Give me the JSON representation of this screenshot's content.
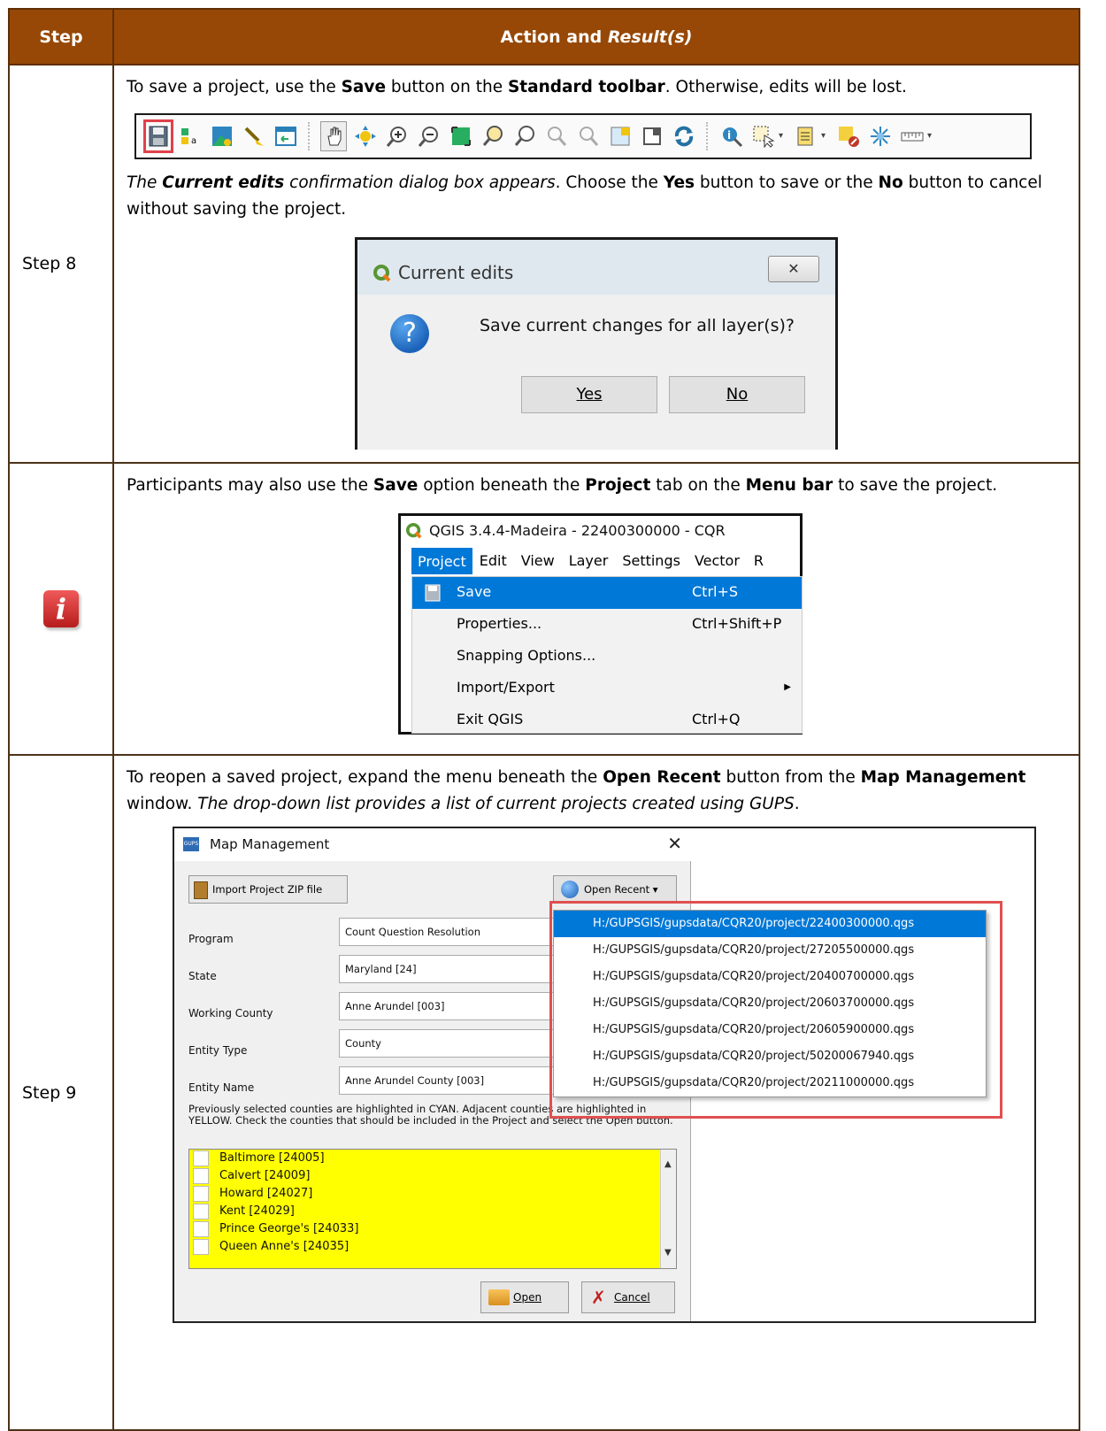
{
  "header": {
    "step": "Step",
    "action": "Action and ",
    "result": "Result(s)"
  },
  "row8": {
    "step": "Step 8",
    "p1": {
      "a": "To save a project, use the ",
      "b1": "Save",
      "c": " button on the ",
      "b2": "Standard toolbar",
      "d": ". Otherwise, edits will be lost."
    },
    "p2": {
      "i1": "The ",
      "bi": "Current edits",
      "i2": " confirmation dialog box appears",
      "a": ". Choose the ",
      "b1": "Yes",
      "c": " button to save or the ",
      "b2": "No",
      "d": " button to cancel without saving the project."
    },
    "dialog": {
      "title": "Current edits",
      "message": "Save current changes for all layer(s)?",
      "yes": "Yes",
      "no": "No",
      "close": "✕"
    }
  },
  "info_row": {
    "icon": "i",
    "p": {
      "a": "Participants may also use the ",
      "b1": "Save",
      "c": " option beneath the ",
      "b2": "Project",
      "d": " tab on the ",
      "b3": "Menu bar",
      "e": " to save the project."
    },
    "qgis": {
      "title": "QGIS 3.4.4-Madeira - 22400300000 - CQR",
      "menubar": [
        "Project",
        "Edit",
        "View",
        "Layer",
        "Settings",
        "Vector",
        "R"
      ],
      "items": [
        {
          "label": "Save",
          "shortcut": "Ctrl+S"
        },
        {
          "label": "Properties...",
          "shortcut": "Ctrl+Shift+P"
        },
        {
          "label": "Snapping Options...",
          "shortcut": ""
        },
        {
          "label": "Import/Export",
          "shortcut": ""
        },
        {
          "label": "Exit QGIS",
          "shortcut": "Ctrl+Q"
        }
      ]
    }
  },
  "row9": {
    "step": "Step 9",
    "p": {
      "a": "To reopen a saved project, expand the menu beneath the ",
      "b1": "Open Recent",
      "c": " button from the ",
      "b2": "Map Management",
      "d": " window. ",
      "i": "The drop-down list provides a list of current projects created using GUPS",
      "e": "."
    },
    "mm": {
      "badge": "GUPS",
      "title": "Map Management",
      "import_btn": "Import Project ZIP file",
      "open_recent": "Open Recent",
      "fields": [
        {
          "label": "Program",
          "value": "Count Question Resolution"
        },
        {
          "label": "State",
          "value": "Maryland [24]"
        },
        {
          "label": "Working County",
          "value": "Anne Arundel [003]"
        },
        {
          "label": "Entity Type",
          "value": "County"
        },
        {
          "label": "Entity Name",
          "value": "Anne Arundel County [003]"
        }
      ],
      "note": "Previously selected counties are highlighted in CYAN. Adjacent counties are highlighted in YELLOW. Check the counties that should be included in the Project and select the Open button.",
      "counties": [
        "Baltimore [24005]",
        "Calvert [24009]",
        "Howard [24027]",
        "Kent [24029]",
        "Prince George's [24033]",
        "Queen Anne's [24035]"
      ],
      "open_btn": "Open",
      "cancel_btn": "Cancel",
      "recent": [
        "H:/GUPSGIS/gupsdata/CQR20/project/22400300000.qgs",
        "H:/GUPSGIS/gupsdata/CQR20/project/27205500000.qgs",
        "H:/GUPSGIS/gupsdata/CQR20/project/20400700000.qgs",
        "H:/GUPSGIS/gupsdata/CQR20/project/20603700000.qgs",
        "H:/GUPSGIS/gupsdata/CQR20/project/20605900000.qgs",
        "H:/GUPSGIS/gupsdata/CQR20/project/50200067940.qgs",
        "H:/GUPSGIS/gupsdata/CQR20/project/20211000000.qgs"
      ]
    }
  },
  "colors": {
    "header_bg": "#974806",
    "highlight_red": "#e0404a",
    "selection_blue": "#0078d7",
    "list_yellow": "#ffff00"
  },
  "toolbar_icons": [
    "save-icon",
    "new-print-layout-icon",
    "style-manager-icon",
    "clear-icon",
    "add-layer-icon",
    "pan-icon",
    "pan-to-selection-icon",
    "zoom-in-icon",
    "zoom-out-icon",
    "zoom-full-icon",
    "zoom-to-selection-icon",
    "zoom-to-layer-icon",
    "zoom-last-icon",
    "zoom-next-icon",
    "new-map-view-icon",
    "new-3d-view-icon",
    "refresh-icon",
    "identify-icon",
    "select-features-icon",
    "select-by-value-icon",
    "deselect-icon",
    "field-calculator-icon",
    "measure-icon"
  ]
}
